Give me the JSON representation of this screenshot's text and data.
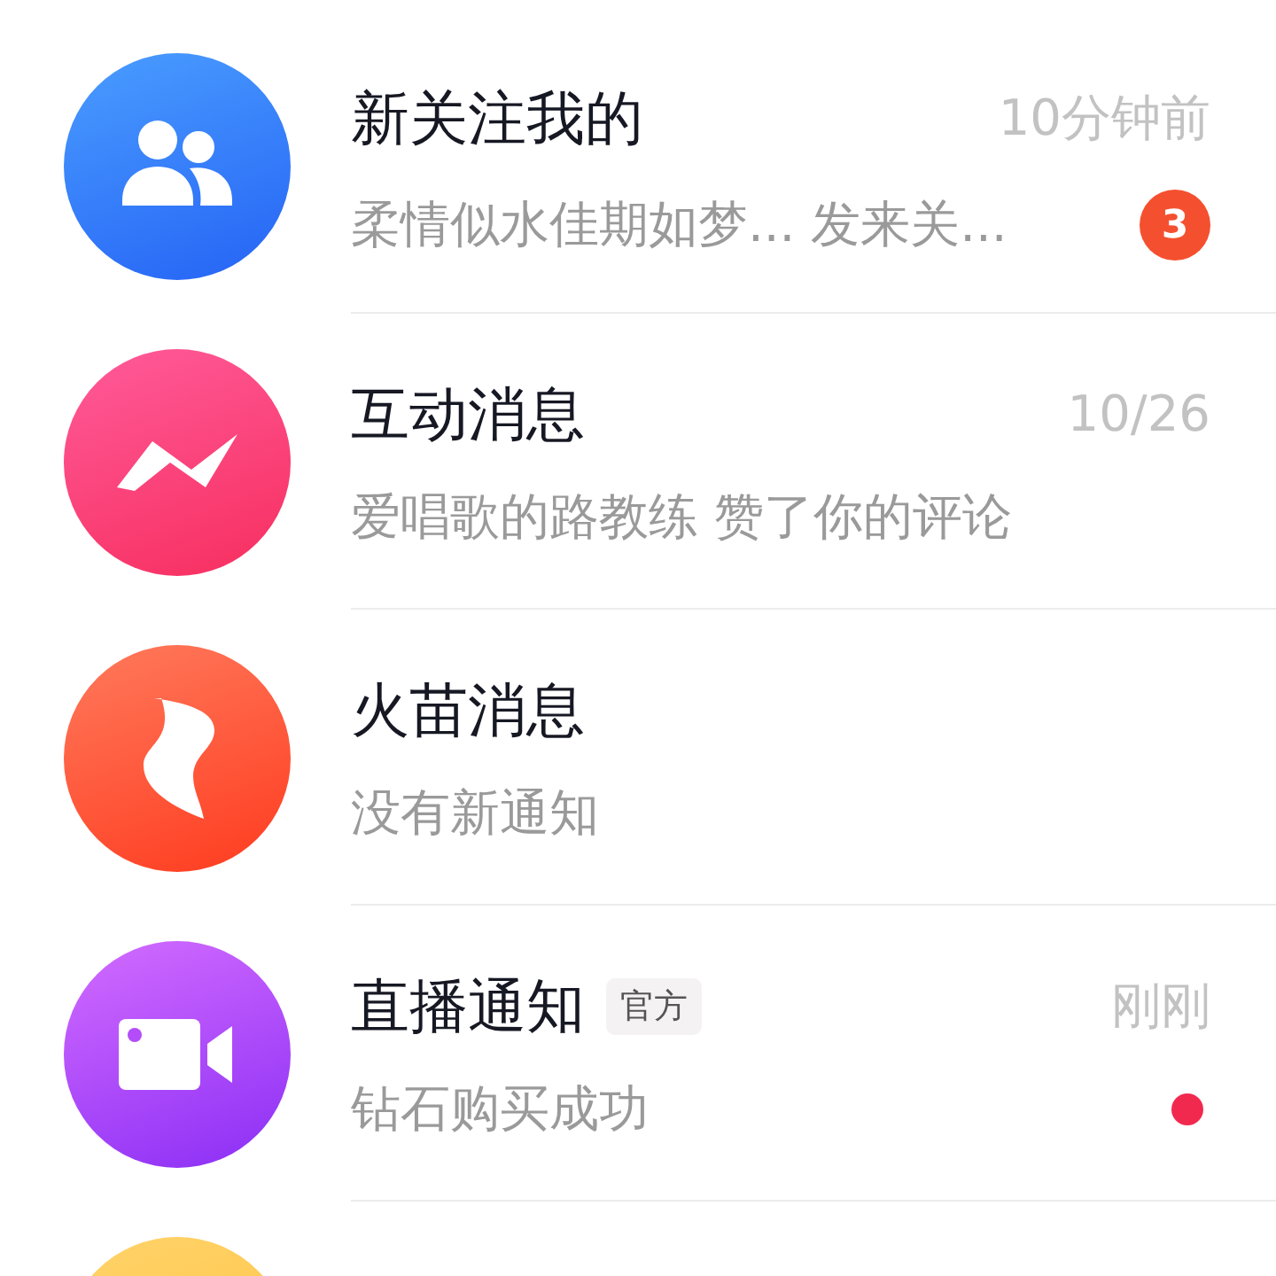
{
  "conversations": [
    {
      "kind": "people",
      "title": "新关注我的",
      "time": "10分钟前",
      "preview": "柔情似水佳期如梦... 发来关...",
      "badge": "3",
      "unread_dot": false
    },
    {
      "kind": "zigzag",
      "title": "互动消息",
      "time": "10/26",
      "preview": "爱唱歌的路教练 赞了你的评论",
      "unread_dot": false
    },
    {
      "kind": "flame",
      "title": "火苗消息",
      "preview": "没有新通知",
      "unread_dot": false
    },
    {
      "kind": "camera",
      "title": "直播通知",
      "tag": "官方",
      "time": "刚刚",
      "preview": "钻石购买成功",
      "unread_dot": true
    },
    {
      "kind": "avatar-only"
    }
  ]
}
